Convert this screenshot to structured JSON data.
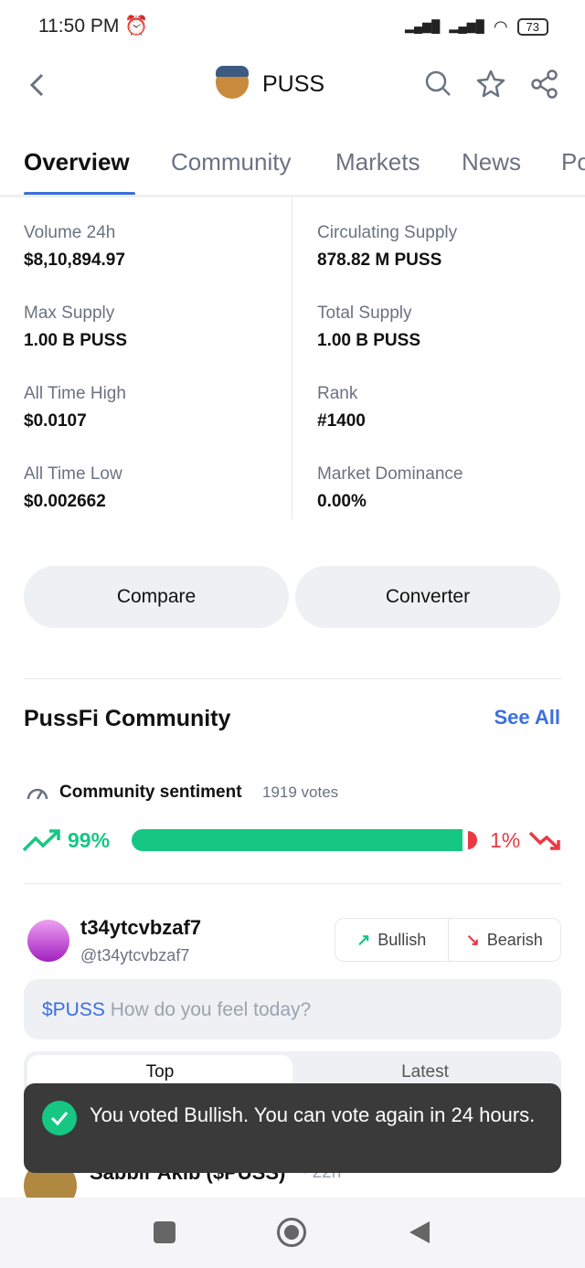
{
  "status_bar": {
    "time": "11:50 PM",
    "battery": "73"
  },
  "header": {
    "title": "PUSS"
  },
  "tabs": [
    "Overview",
    "Community",
    "Markets",
    "News",
    "Po"
  ],
  "stats": {
    "left": [
      {
        "label": "Volume 24h",
        "value": "$8,10,894.97"
      },
      {
        "label": "Max Supply",
        "value": "1.00 B PUSS"
      },
      {
        "label": "All Time High",
        "value": "$0.0107"
      },
      {
        "label": "All Time Low",
        "value": "$0.002662"
      }
    ],
    "right": [
      {
        "label": "Circulating Supply",
        "value": "878.82 M PUSS"
      },
      {
        "label": "Total Supply",
        "value": "1.00 B PUSS"
      },
      {
        "label": "Rank",
        "value": "#1400"
      },
      {
        "label": "Market Dominance",
        "value": "0.00%"
      }
    ]
  },
  "buttons": {
    "compare": "Compare",
    "converter": "Converter"
  },
  "community": {
    "title": "PussFi Community",
    "see_all": "See All",
    "sentiment_label": "Community sentiment",
    "votes": "1919 votes",
    "bullish_pct": "99%",
    "bearish_pct": "1%",
    "bullish_fraction": 0.99,
    "colors": {
      "bullish": "#16c784",
      "bearish": "#ea3943",
      "accent": "#3b6fe0"
    }
  },
  "user": {
    "name": "t34ytcvbzaf7",
    "handle": "@t34ytcvbzaf7",
    "bullish": "Bullish",
    "bearish": "Bearish"
  },
  "post_input": {
    "ticker": "$PUSS",
    "placeholder": "How do you feel today?"
  },
  "feed_tabs": {
    "top": "Top",
    "latest": "Latest"
  },
  "post": {
    "author": "Sabbir Akib ($PUSS)",
    "time": "· 22h"
  },
  "toast": {
    "message": "You voted Bullish. You can vote again in 24 hours."
  }
}
